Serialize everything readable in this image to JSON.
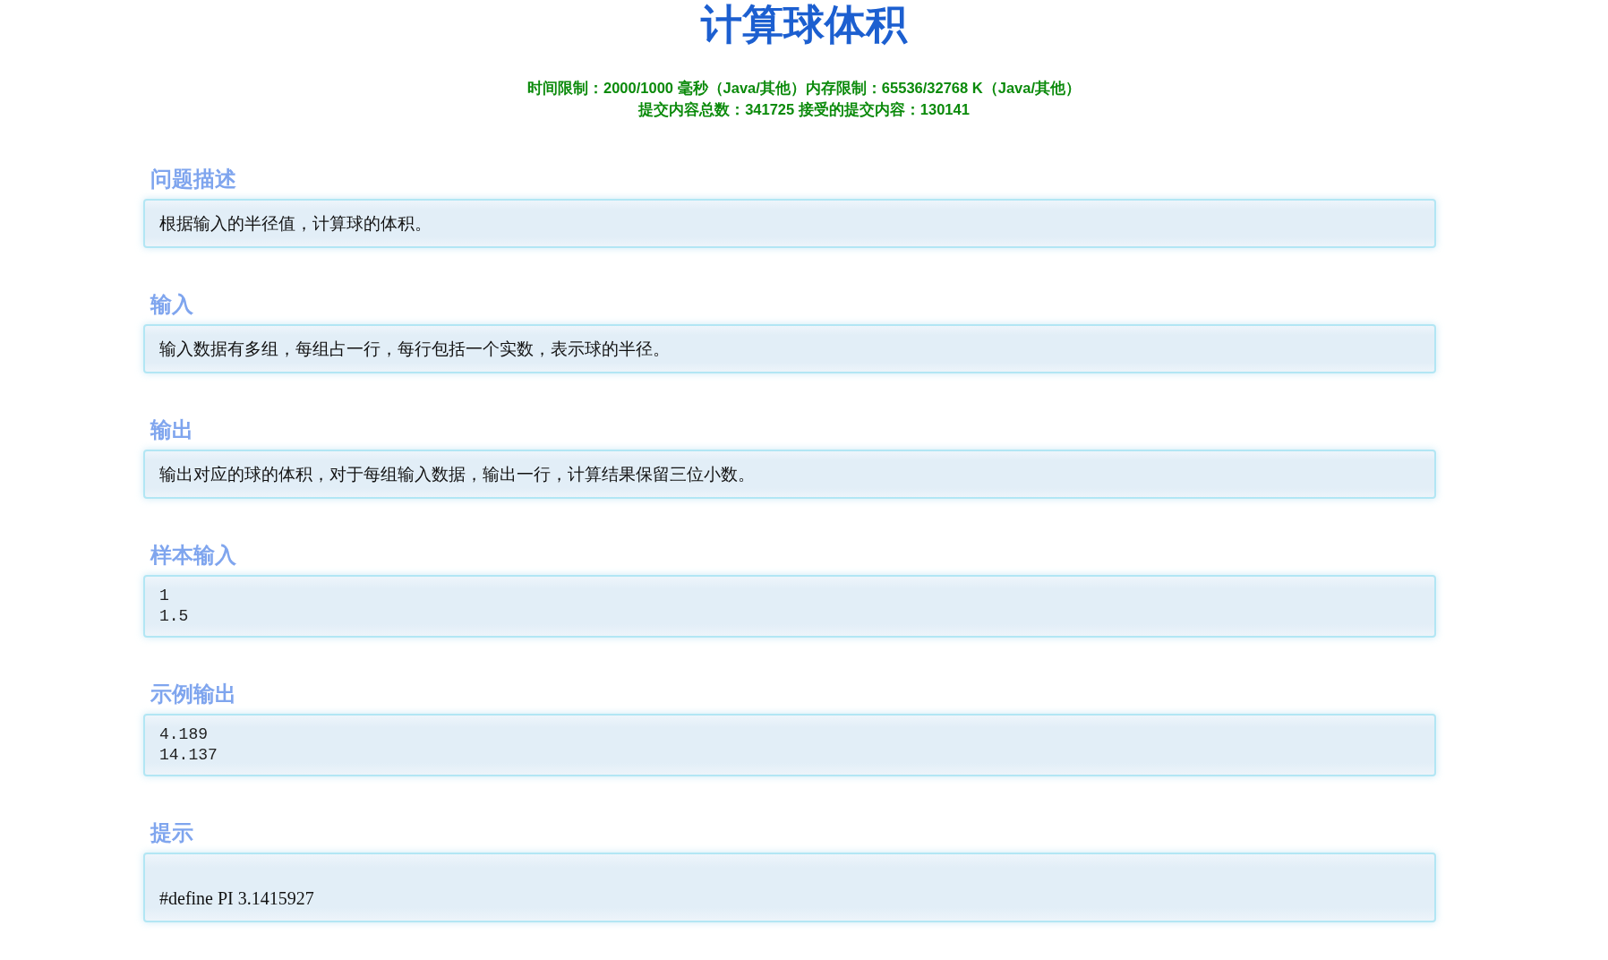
{
  "title": "计算球体积",
  "info_lines": [
    "时间限制：2000/1000 毫秒（Java/其他）内存限制：65536/32768 K（Java/其他）",
    "提交内容总数：341725 接受的提交内容：130141"
  ],
  "sections": [
    {
      "heading": "问题描述",
      "kind": "text",
      "lines": [
        "根据输入的半径值，计算球的体积。"
      ]
    },
    {
      "heading": "输入",
      "kind": "text",
      "lines": [
        "输入数据有多组，每组占一行，每行包括一个实数，表示球的半径。"
      ]
    },
    {
      "heading": "输出",
      "kind": "text",
      "lines": [
        "输出对应的球的体积，对于每组输入数据，输出一行，计算结果保留三位小数。"
      ]
    },
    {
      "heading": "样本输入",
      "kind": "code",
      "lines": [
        "1",
        "1.5"
      ]
    },
    {
      "heading": "示例输出",
      "kind": "code",
      "lines": [
        "4.189",
        "14.137"
      ]
    },
    {
      "heading": "提示",
      "kind": "hint",
      "lines": [
        "#define PI 3.1415927"
      ]
    }
  ]
}
